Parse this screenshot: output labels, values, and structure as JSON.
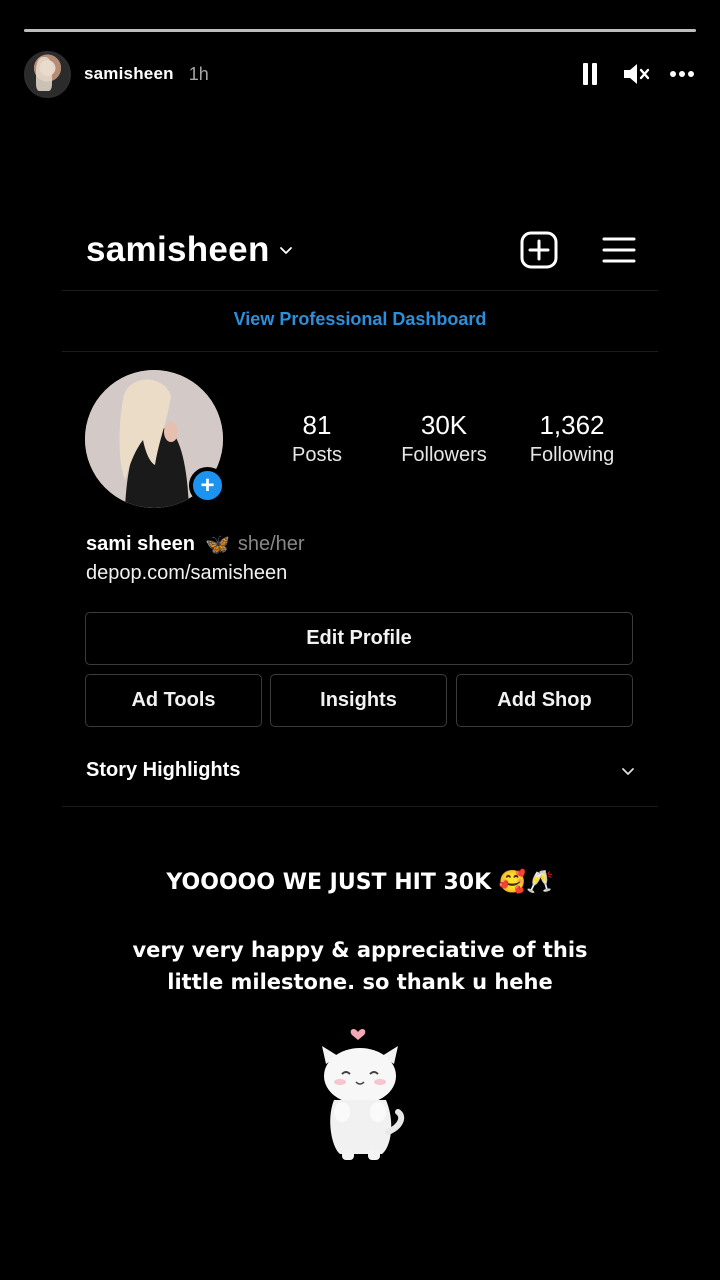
{
  "story": {
    "progress": 1.0,
    "username": "samisheen",
    "time": "1h"
  },
  "profile": {
    "username": "samisheen",
    "dashboard_link": "View Professional Dashboard",
    "stats": [
      {
        "value": "81",
        "label": "Posts"
      },
      {
        "value": "30K",
        "label": "Followers"
      },
      {
        "value": "1,362",
        "label": "Following"
      }
    ],
    "name": "sami sheen",
    "name_emoji": "🦋",
    "pronouns": "she/her",
    "link": "depop.com/samisheen",
    "buttons": {
      "edit": "Edit Profile",
      "ad_tools": "Ad Tools",
      "insights": "Insights",
      "add_shop": "Add Shop"
    },
    "highlights_label": "Story Highlights"
  },
  "caption": {
    "line1": "YOOOOO WE JUST HIT 30K 🥰🥂",
    "line2a": "very very happy & appreciative of this",
    "line2b": "little milestone. so thank u hehe"
  },
  "colors": {
    "accent": "#2d8fd9",
    "badge": "#1d93f0",
    "background": "#000000"
  },
  "icons": [
    "pause-icon",
    "mute-icon",
    "more-icon",
    "chevron-down-icon",
    "add-post-icon",
    "menu-icon",
    "cat-sticker"
  ]
}
